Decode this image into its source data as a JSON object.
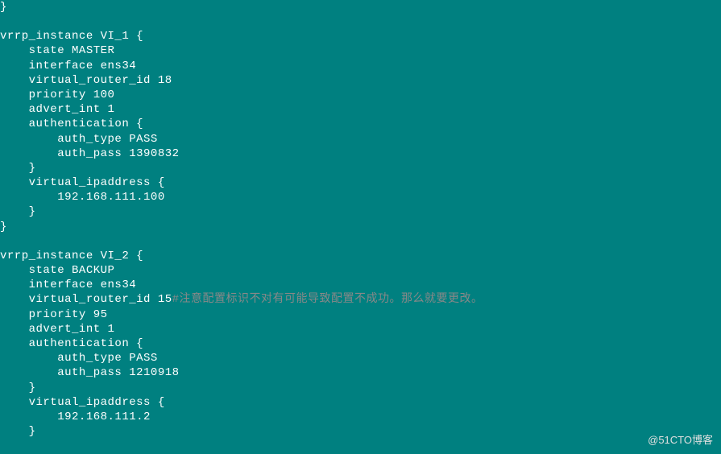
{
  "terminal": {
    "lines": [
      {
        "text": "}",
        "indent": 0
      },
      {
        "text": "",
        "indent": 0
      },
      {
        "text": "vrrp_instance VI_1 {",
        "indent": 0
      },
      {
        "text": "state MASTER",
        "indent": 4
      },
      {
        "text": "interface ens34",
        "indent": 4
      },
      {
        "text": "virtual_router_id 18",
        "indent": 4
      },
      {
        "text": "priority 100",
        "indent": 4
      },
      {
        "text": "advert_int 1",
        "indent": 4
      },
      {
        "text": "authentication {",
        "indent": 4
      },
      {
        "text": "auth_type PASS",
        "indent": 8
      },
      {
        "text": "auth_pass 1390832",
        "indent": 8
      },
      {
        "text": "}",
        "indent": 4
      },
      {
        "text": "virtual_ipaddress {",
        "indent": 4
      },
      {
        "text": "192.168.111.100",
        "indent": 8
      },
      {
        "text": "}",
        "indent": 4
      },
      {
        "text": "}",
        "indent": 0
      },
      {
        "text": "",
        "indent": 0
      },
      {
        "text": "vrrp_instance VI_2 {",
        "indent": 0
      },
      {
        "text": "state BACKUP",
        "indent": 4
      },
      {
        "text": "interface ens34",
        "indent": 4
      },
      {
        "text": "virtual_router_id 15",
        "indent": 4,
        "comment": "#注意配置标识不对有可能导致配置不成功。那么就要更改。"
      },
      {
        "text": "priority 95",
        "indent": 4
      },
      {
        "text": "advert_int 1",
        "indent": 4
      },
      {
        "text": "authentication {",
        "indent": 4
      },
      {
        "text": "auth_type PASS",
        "indent": 8
      },
      {
        "text": "auth_pass 1210918",
        "indent": 8
      },
      {
        "text": "}",
        "indent": 4
      },
      {
        "text": "virtual_ipaddress {",
        "indent": 4
      },
      {
        "text": "192.168.111.2",
        "indent": 8
      },
      {
        "text": "}",
        "indent": 4
      }
    ]
  },
  "watermark": "@51CTO博客"
}
